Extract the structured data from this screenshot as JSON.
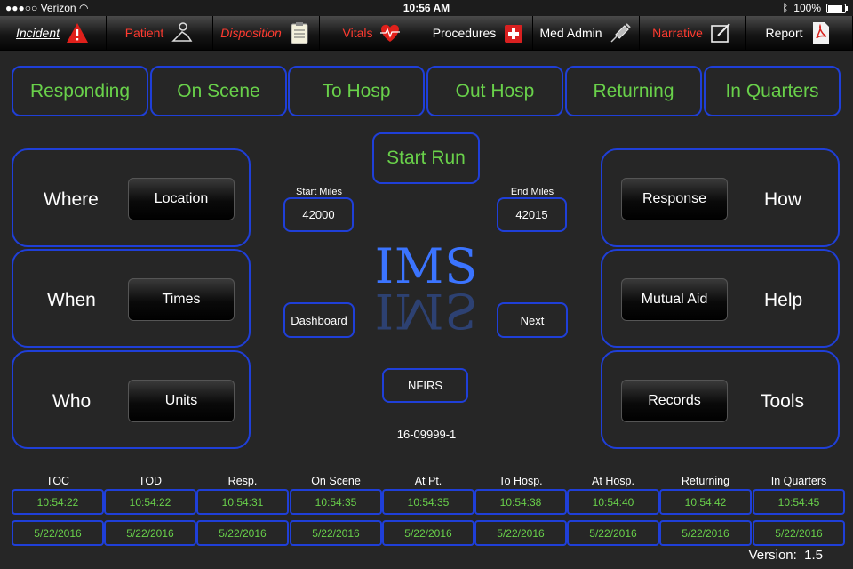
{
  "status_bar": {
    "carrier": "●●●○○ Verizon",
    "time": "10:56 AM",
    "battery": "100%",
    "battery_level": 1.0
  },
  "tabs": [
    {
      "label": "Incident",
      "style": "underline",
      "icon": "warning-icon"
    },
    {
      "label": "Patient",
      "style": "red",
      "icon": "patient-icon"
    },
    {
      "label": "Disposition",
      "style": "red",
      "icon": "clipboard-icon"
    },
    {
      "label": "Vitals",
      "style": "red",
      "icon": "heart-icon"
    },
    {
      "label": "Procedures",
      "style": "white",
      "icon": "medkit-icon"
    },
    {
      "label": "Med Admin",
      "style": "white",
      "icon": "syringe-icon"
    },
    {
      "label": "Narrative",
      "style": "red",
      "icon": "edit-icon"
    },
    {
      "label": "Report",
      "style": "white",
      "icon": "pdf-icon"
    }
  ],
  "status_buttons": [
    "Responding",
    "On Scene",
    "To Hosp",
    "Out Hosp",
    "Returning",
    "In Quarters"
  ],
  "start_run": "Start Run",
  "left_panels": [
    {
      "label": "Where",
      "button": "Location"
    },
    {
      "label": "When",
      "button": "Times"
    },
    {
      "label": "Who",
      "button": "Units"
    }
  ],
  "right_panels": [
    {
      "label": "How",
      "button": "Response"
    },
    {
      "label": "Help",
      "button": "Mutual Aid"
    },
    {
      "label": "Tools",
      "button": "Records"
    }
  ],
  "miles": {
    "start_label": "Start Miles",
    "start_value": "42000",
    "end_label": "End Miles",
    "end_value": "42015"
  },
  "logo": "IMS",
  "dashboard": "Dashboard",
  "next": "Next",
  "nfirs": "NFIRS",
  "incident_number": "16-09999-1",
  "timeline": [
    {
      "label": "TOC",
      "time": "10:54:22",
      "date": "5/22/2016"
    },
    {
      "label": "TOD",
      "time": "10:54:22",
      "date": "5/22/2016"
    },
    {
      "label": "Resp.",
      "time": "10:54:31",
      "date": "5/22/2016"
    },
    {
      "label": "On Scene",
      "time": "10:54:35",
      "date": "5/22/2016"
    },
    {
      "label": "At Pt.",
      "time": "10:54:35",
      "date": "5/22/2016"
    },
    {
      "label": "To Hosp.",
      "time": "10:54:38",
      "date": "5/22/2016"
    },
    {
      "label": "At Hosp.",
      "time": "10:54:40",
      "date": "5/22/2016"
    },
    {
      "label": "Returning",
      "time": "10:54:42",
      "date": "5/22/2016"
    },
    {
      "label": "In Quarters",
      "time": "10:54:45",
      "date": "5/22/2016"
    }
  ],
  "version": {
    "label": "Version:",
    "value": "1.5"
  },
  "colors": {
    "accent_blue": "#1f3fd8",
    "green_text": "#69d14a",
    "red_tab": "#ff3b30",
    "logo_blue": "#3b74ff"
  }
}
